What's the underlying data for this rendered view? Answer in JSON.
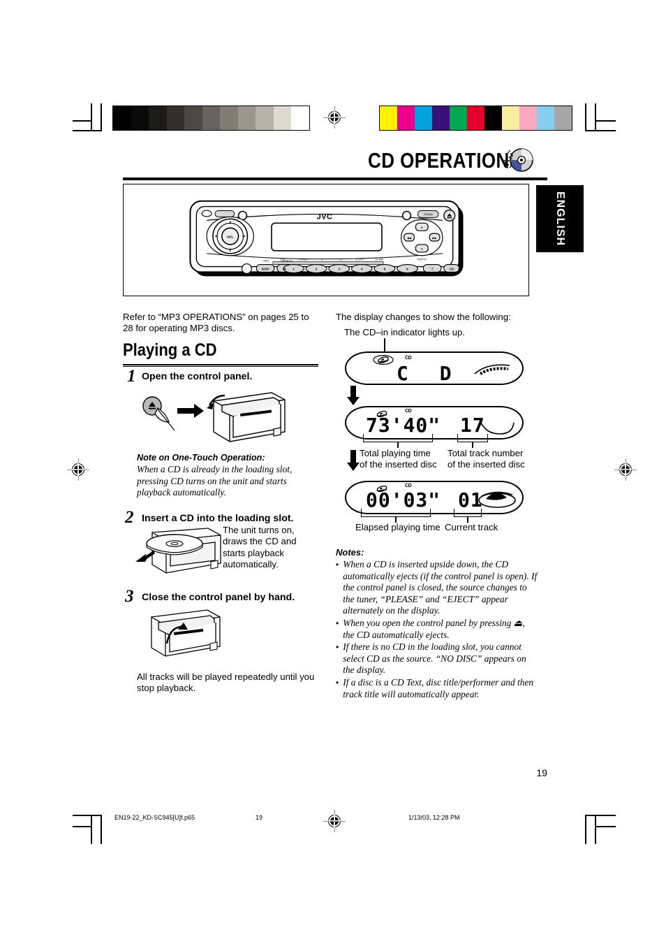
{
  "header": {
    "title": "CD OPERATIONS",
    "cd_icon": "compact-disc-icon",
    "language_tab": "ENGLISH"
  },
  "faceplate": {
    "brand": "JVC",
    "eject_label": "eject-icon",
    "buttons": [
      "1",
      "2",
      "3",
      "4",
      "5",
      "6"
    ],
    "indicators": [
      "7  DI",
      "8  RND",
      "9",
      "10",
      "11 RPT",
      "12 RM"
    ],
    "knob_label": "SEL",
    "left_labels": [
      "RESET",
      "DISP",
      "SOURCE",
      "BAND",
      "MODE"
    ],
    "right_labels": [
      "TP/PTY",
      "T/P-RM",
      "CD"
    ]
  },
  "intro": {
    "text": "Refer to “MP3 OPERATIONS” on pages 25 to 28 for operating MP3 discs."
  },
  "section": {
    "heading": "Playing a CD"
  },
  "steps": [
    {
      "num": "1",
      "heading": "Open the control panel.",
      "note_title": "Note on One-Touch Operation:",
      "note_body": "When a CD is already in the loading slot, pressing CD turns on the unit and starts playback automatically."
    },
    {
      "num": "2",
      "heading": "Insert a CD into the loading slot.",
      "side_text": "The unit turns on, draws the CD and starts playback automatically."
    },
    {
      "num": "3",
      "heading": "Close the control panel by hand.",
      "after_text": "All tracks will be played repeatedly until you stop playback."
    }
  ],
  "display_column": {
    "intro": "The display changes to show the following:",
    "callout": "The CD–in indicator lights up.",
    "screens": [
      {
        "name": "cd-screen",
        "left_segment": "C D",
        "right_segment": "",
        "indicator_cd": "CD"
      },
      {
        "name": "total-time-screen",
        "left_segment": "73'40\"",
        "right_segment": "17",
        "indicator_cd": "CD"
      },
      {
        "name": "elapsed-time-screen",
        "left_segment": "00'03\"",
        "right_segment": "01",
        "indicator_cd": "CD"
      }
    ],
    "labels_total": {
      "left_line1": "Total playing time",
      "left_line2": "of the inserted disc",
      "right_line1": "Total track number",
      "right_line2": "of the inserted disc"
    },
    "labels_elapsed": {
      "left": "Elapsed playing time",
      "right": "Current track"
    }
  },
  "notes": {
    "title": "Notes:",
    "items": [
      "When a CD is inserted upside down, the CD automatically ejects (if the control panel is open). If the control panel is closed, the source changes to the tuner, “PLEASE” and “EJECT” appear alternately on the display.",
      "When you open the control panel by pressing ⏏, the CD automatically ejects.",
      "If there is no CD in the loading slot, you cannot select CD as the source. “NO DISC” appears on the display.",
      "If a disc is a CD Text, disc title/performer and then track title will automatically appear."
    ]
  },
  "footer": {
    "page_number": "19",
    "file_name": "EN19-22_KD-SC945[U]f.p65",
    "sheet_number": "19",
    "timestamp": "1/13/03, 12:28 PM"
  },
  "color_bars": {
    "grayscale": [
      "#000000",
      "#0a0a0a",
      "#1c1a18",
      "#33302c",
      "#4c4843",
      "#68635c",
      "#827c74",
      "#9d968d",
      "#b8b2a9",
      "#dedad2",
      "#ffffff"
    ],
    "colors": [
      "#fff200",
      "#ec008c",
      "#00a3e0",
      "#3b0f7a",
      "#00a651",
      "#e4002b",
      "#000000",
      "#f9eea1",
      "#f9a8c2",
      "#86cdf0",
      "#a6a6a6"
    ]
  }
}
